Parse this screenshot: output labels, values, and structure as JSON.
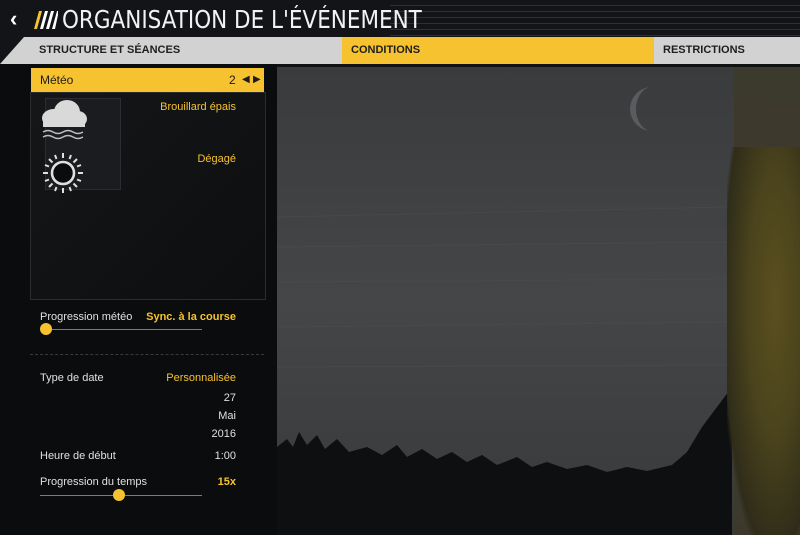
{
  "header": {
    "title": "ORGANISATION DE L'ÉVÉNEMENT",
    "back_icon": "chevron-left-icon",
    "logo_icon": "stripes-logo-icon"
  },
  "tabs": [
    {
      "label": "STRUCTURE ET SÉANCES",
      "active": false
    },
    {
      "label": "CONDITIONS",
      "active": true
    },
    {
      "label": "RESTRICTIONS",
      "active": false
    }
  ],
  "weather": {
    "label": "Météo",
    "count": "2",
    "slots": [
      {
        "icon": "fog-cloud-icon",
        "value": "Brouillard épais"
      },
      {
        "icon": "sun-icon",
        "value": "Dégagé"
      }
    ],
    "progression_label": "Progression météo",
    "progression_value": "Sync. à la course"
  },
  "date": {
    "type_label": "Type de date",
    "type_value": "Personnalisée",
    "day": "27",
    "month": "Mai",
    "year": "2016",
    "start_label": "Heure de début",
    "start_value": "1:00",
    "time_prog_label": "Progression du temps",
    "time_prog_value": "15x"
  },
  "colors": {
    "accent": "#f7c22f",
    "tab_bg": "#d2d2d2",
    "panel_bg": "#0b0c0d"
  },
  "sliders": {
    "weather_progression_fraction": 0.0,
    "time_progression_fraction": 0.45
  }
}
